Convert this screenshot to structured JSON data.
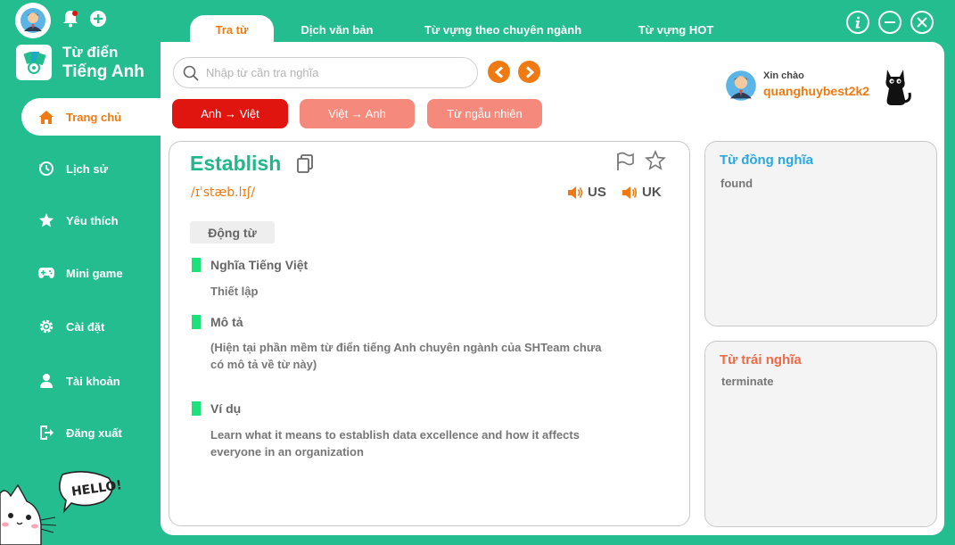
{
  "app": {
    "title_line1": "Từ điển",
    "title_line2": "Tiếng Anh"
  },
  "sidebar": {
    "items": [
      {
        "label": "Trang chủ",
        "icon": "home-icon",
        "active": true
      },
      {
        "label": "Lịch sử",
        "icon": "history-icon"
      },
      {
        "label": "Yêu thích",
        "icon": "star-icon"
      },
      {
        "label": "Mini game",
        "icon": "gamepad-icon"
      },
      {
        "label": "Cài đặt",
        "icon": "gear-icon"
      },
      {
        "label": "Tài khoản",
        "icon": "user-icon"
      },
      {
        "label": "Đăng xuất",
        "icon": "logout-icon"
      }
    ]
  },
  "tabs": [
    {
      "label": "Tra từ",
      "active": true
    },
    {
      "label": "Dịch văn bản"
    },
    {
      "label": "Từ vựng theo chuyên ngành"
    },
    {
      "label": "Từ vựng HOT"
    }
  ],
  "search": {
    "placeholder": "Nhập từ cần tra nghĩa",
    "value": ""
  },
  "modes": [
    {
      "label": "Anh → Việt",
      "active": true
    },
    {
      "label": "Việt → Anh"
    },
    {
      "label": "Từ ngẫu nhiên"
    }
  ],
  "greeting": {
    "hello": "Xin chào",
    "username": "quanghuybest2k2"
  },
  "word": {
    "term": "Establish",
    "phonetic": "/ɪˈstæb.lɪʃ/",
    "pron_us": "US",
    "pron_uk": "UK",
    "part_of_speech": "Động từ",
    "meaning_title": "Nghĩa Tiếng Việt",
    "meaning": "Thiết lập",
    "description_title": "Mô tả",
    "description_line1": "(Hiện tại phần mềm từ điển tiếng Anh chuyên ngành của SHTeam chưa",
    "description_line2": "có mô tả về từ này)",
    "example_title": "Ví dụ",
    "example_line1": "Learn what it means to establish data excellence and how it affects",
    "example_line2": "everyone in an organization"
  },
  "synonyms": {
    "title": "Từ đồng nghĩa",
    "value": "found"
  },
  "antonyms": {
    "title": "Từ trái nghĩa",
    "value": "terminate"
  },
  "mascot": {
    "speech": "HELLO!"
  },
  "colors": {
    "brand_green": "#23bd8f",
    "accent_orange": "#f07a12",
    "mode_active": "#e0150f",
    "mode_inactive": "#f58a7c",
    "synonym_title": "#29a9e0",
    "antonym_title": "#f06a47",
    "section_marker": "#1de27a"
  }
}
